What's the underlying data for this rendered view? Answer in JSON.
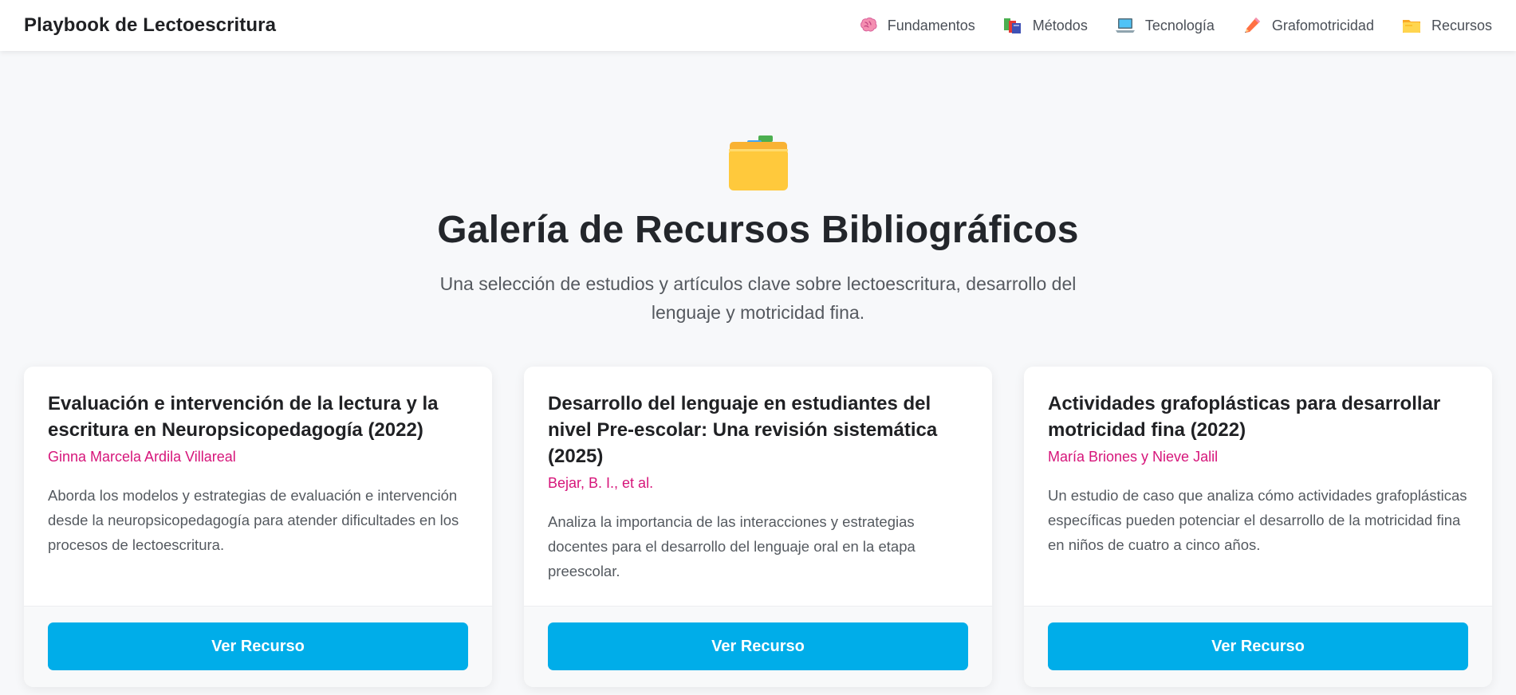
{
  "header": {
    "brand": "Playbook de Lectoescritura",
    "nav": [
      {
        "label": "Fundamentos",
        "icon": "brain-icon"
      },
      {
        "label": "Métodos",
        "icon": "books-icon"
      },
      {
        "label": "Tecnología",
        "icon": "laptop-icon"
      },
      {
        "label": "Grafomotricidad",
        "icon": "pencil-icon"
      },
      {
        "label": "Recursos",
        "icon": "folder-icon"
      }
    ]
  },
  "hero": {
    "icon": "card-index-dividers-icon",
    "title": "Galería de Recursos Bibliográficos",
    "subtitle": "Una selección de estudios y artículos clave sobre lectoescritura, desarrollo del lenguaje y motricidad fina."
  },
  "cards": [
    {
      "title": "Evaluación e intervención de la lectura y la escritura en Neuropsicopedagogía (2022)",
      "author": "Ginna Marcela Ardila Villareal",
      "description": "Aborda los modelos y estrategias de evaluación e intervención desde la neuropsicopedagogía para atender dificultades en los procesos de lectoescritura.",
      "button": "Ver Recurso"
    },
    {
      "title": "Desarrollo del lenguaje en estudiantes del nivel Pre-escolar: Una revisión sistemática (2025)",
      "author": "Bejar, B. I., et al.",
      "description": "Analiza la importancia de las interacciones y estrategias docentes para el desarrollo del lenguaje oral en la etapa preescolar.",
      "button": "Ver Recurso"
    },
    {
      "title": "Actividades grafoplásticas para desarrollar motricidad fina (2022)",
      "author": "María Briones y Nieve Jalil",
      "description": "Un estudio de caso que analiza cómo actividades grafoplásticas específicas pueden potenciar el desarrollo de la motricidad fina en niños de cuatro a cinco años.",
      "button": "Ver Recurso"
    }
  ],
  "colors": {
    "accent": "#00ade9",
    "author": "#d6157a",
    "background": "#f7f8fa"
  }
}
